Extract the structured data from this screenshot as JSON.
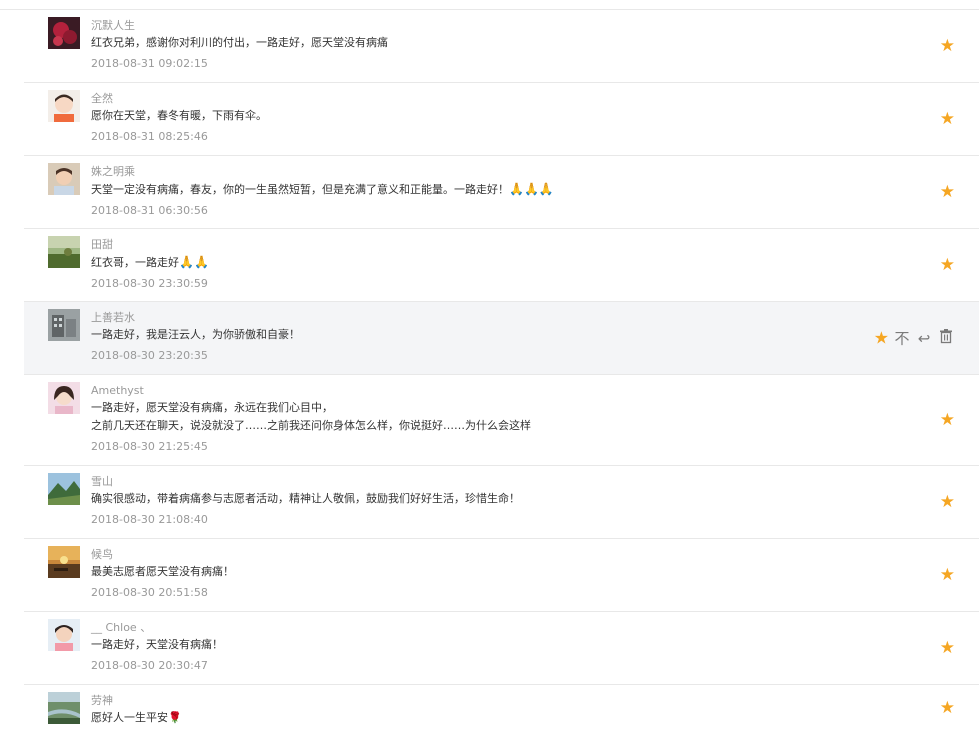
{
  "colors": {
    "star": "#f5a623",
    "hover_bg": "#f4f5f7",
    "divider": "#e8e8e8",
    "meta": "#999999",
    "text": "#333333"
  },
  "comments": [
    {
      "author": "沉默人生",
      "lines": [
        "红衣兄弟，感谢你对利川的付出，一路走好，愿天堂没有病痛"
      ],
      "time": "2018-08-31 09:02:15",
      "avatar": "red-flowers"
    },
    {
      "author": "全然",
      "lines": [
        "愿你在天堂，春冬有暖，下雨有伞。"
      ],
      "time": "2018-08-31 08:25:46",
      "avatar": "cartoon-boy"
    },
    {
      "author": "姝之明乘",
      "lines": [
        "天堂一定没有病痛，春友，你的一生虽然短暂，但是充满了意义和正能量。一路走好！"
      ],
      "suffix": "🙏🙏🙏",
      "time": "2018-08-31 06:30:56",
      "avatar": "child"
    },
    {
      "author": "田甜",
      "lines": [
        "红衣哥，一路走好"
      ],
      "suffix": "🙏🙏",
      "time": "2018-08-30 23:30:59",
      "avatar": "meadow"
    },
    {
      "author": "上善若水",
      "lines": [
        "一路走好，我是汪云人，为你骄傲和自豪！"
      ],
      "time": "2018-08-30 23:20:35",
      "avatar": "building",
      "hover": true
    },
    {
      "author": "Amethyst",
      "lines": [
        "一路走好，愿天堂没有病痛，永远在我们心目中，",
        "之前几天还在聊天，说没就没了……之前我还问你身体怎么样，你说挺好……为什么会这样"
      ],
      "time": "2018-08-30 21:25:45",
      "avatar": "girl"
    },
    {
      "author": "雪山",
      "lines": [
        "确实很感动，带着病痛参与志愿者活动，精神让人敬佩，鼓励我们好好生活，珍惜生命！"
      ],
      "time": "2018-08-30 21:08:40",
      "avatar": "mountain"
    },
    {
      "author": "候鸟",
      "lines": [
        "最美志愿者愿天堂没有病痛！"
      ],
      "time": "2018-08-30 20:51:58",
      "avatar": "sunset"
    },
    {
      "author": "__ Chloe 、",
      "lines": [
        "一路走好，天堂没有病痛！"
      ],
      "time": "2018-08-30 20:30:47",
      "avatar": "little-girl"
    },
    {
      "author": "劳神",
      "lines": [
        "愿好人一生平安"
      ],
      "suffix": "🌹",
      "time": "",
      "avatar": "river"
    }
  ],
  "icons": {
    "star": "★",
    "dislike": "不",
    "reply": "↩",
    "delete": "🗑"
  }
}
